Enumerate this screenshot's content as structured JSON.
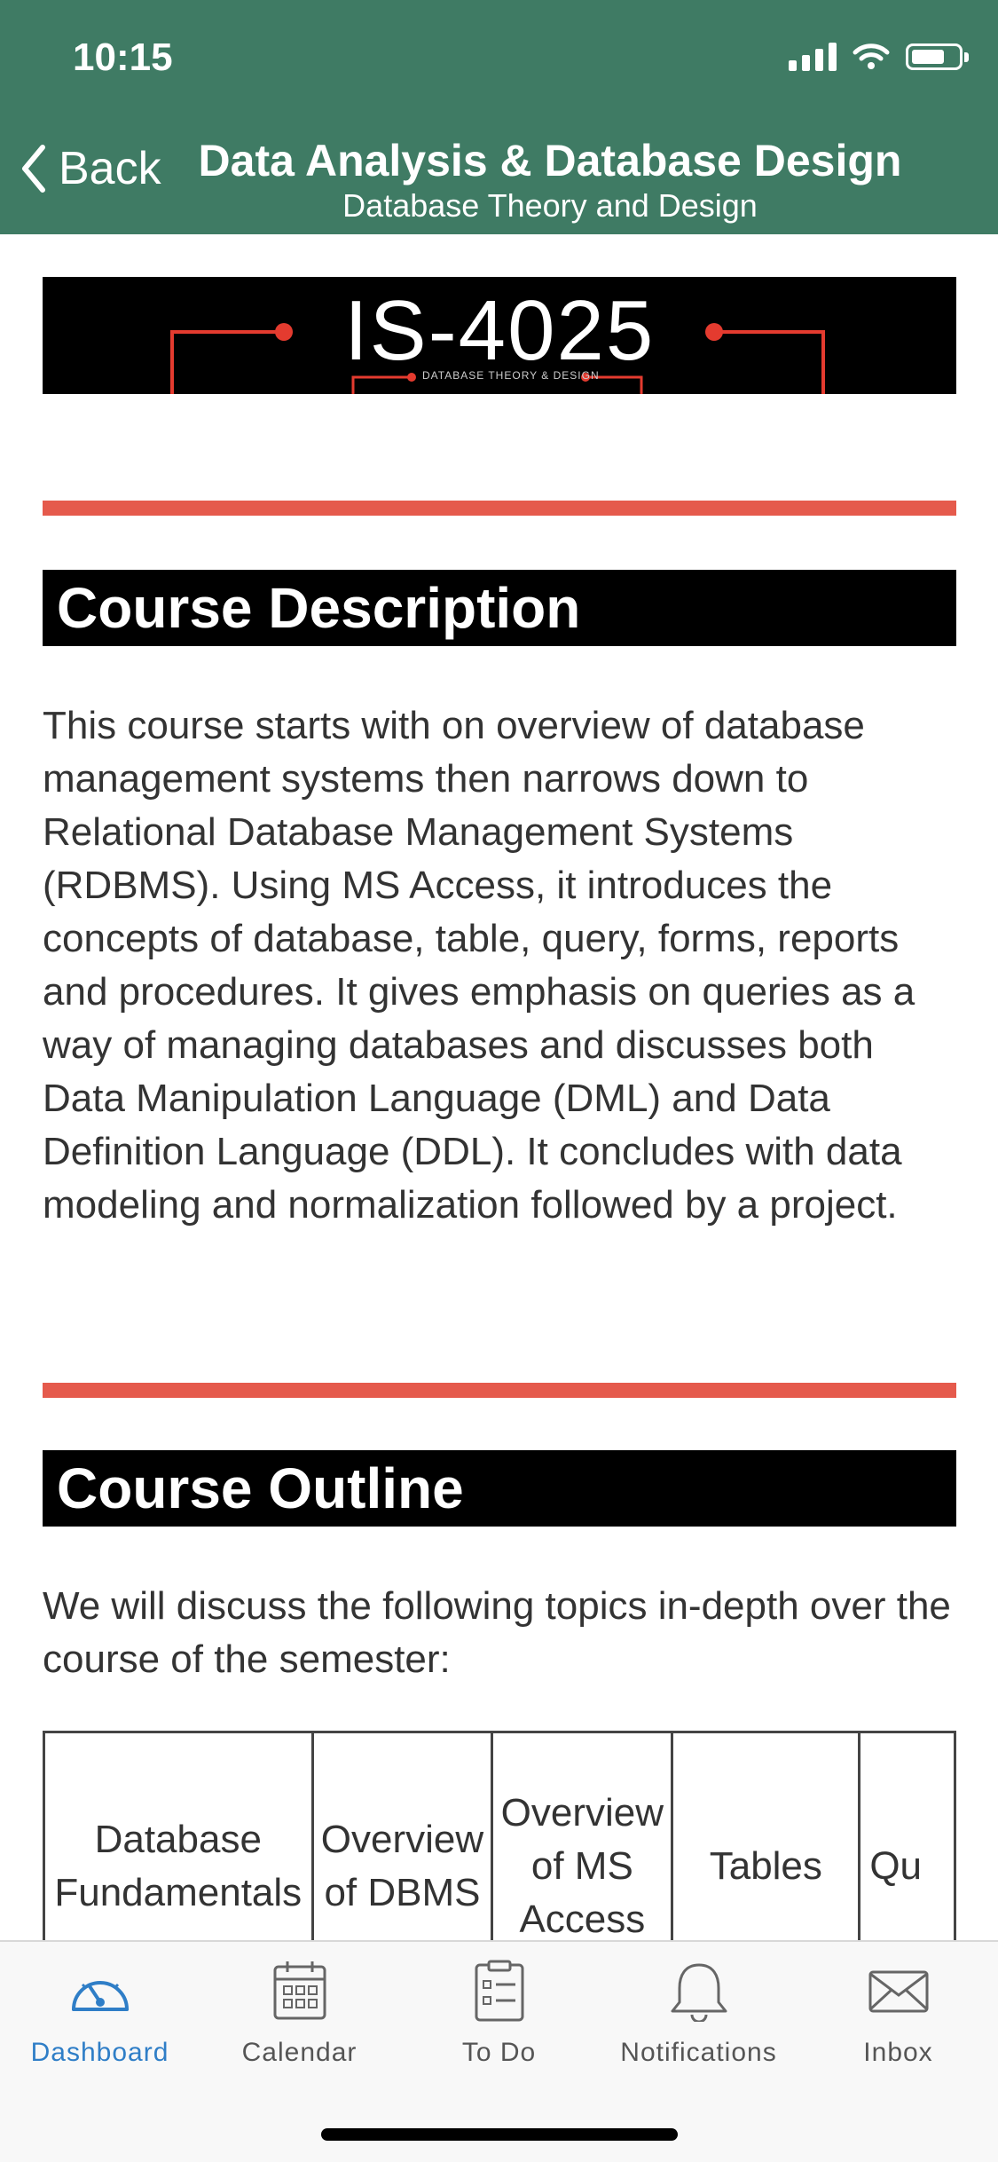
{
  "status_bar": {
    "time": "10:15"
  },
  "nav": {
    "back_label": "Back",
    "title": "Data Analysis & Database Design",
    "subtitle": "Database Theory and Design"
  },
  "banner": {
    "code": "IS-4025",
    "subtitle": "DATABASE THEORY & DESIGN"
  },
  "course_description": {
    "heading": "Course Description",
    "text": "This course starts with on overview of database management systems then narrows down to Relational Database Management Systems (RDBMS). Using MS Access, it introduces the concepts of database, table, query, forms, reports and procedures. It gives emphasis on queries as a way of managing databases and discusses both Data Manipulation Language (DML) and Data Definition Language (DDL). It concludes with data modeling and normalization followed by a project."
  },
  "course_outline": {
    "heading": "Course Outline",
    "intro": "We will discuss the following topics in-depth over the course of the semester:",
    "topics": [
      "Database Fundamentals",
      "Overview of DBMS",
      "Overview of MS Access",
      "Tables",
      "Qu"
    ]
  },
  "tabbar": {
    "items": [
      {
        "label": "Dashboard",
        "icon": "dashboard-icon"
      },
      {
        "label": "Calendar",
        "icon": "calendar-icon"
      },
      {
        "label": "To Do",
        "icon": "todo-icon"
      },
      {
        "label": "Notifications",
        "icon": "bell-icon"
      },
      {
        "label": "Inbox",
        "icon": "envelope-icon"
      }
    ]
  },
  "colors": {
    "header": "#3f7b64",
    "accent_rule": "#e55a4c",
    "active_tab": "#2f7ec7"
  }
}
